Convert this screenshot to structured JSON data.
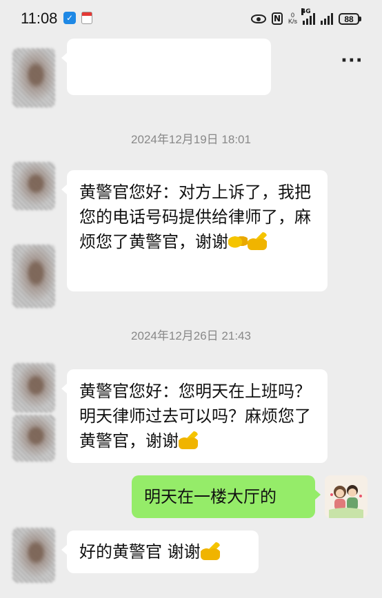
{
  "status_bar": {
    "time": "11:08",
    "net_speed_value": "0",
    "net_speed_unit": "K/s",
    "network_type": "4G",
    "battery": "88"
  },
  "header": {
    "more_label": "···"
  },
  "messages": [
    {
      "type": "timestamp",
      "text": "2024年12月19日 18:01"
    },
    {
      "type": "incoming",
      "text": "黄警官您好：对方上诉了，我把您的电话号码提供给律师了，麻烦您了黄警官，谢谢",
      "emojis": [
        "handshake",
        "folded-hands"
      ]
    },
    {
      "type": "timestamp",
      "text": "2024年12月26日 21:43"
    },
    {
      "type": "incoming",
      "text": "黄警官您好：您明天在上班吗？明天律师过去可以吗？麻烦您了黄警官，谢谢",
      "emojis": [
        "folded-hands"
      ]
    },
    {
      "type": "outgoing",
      "text": "明天在一楼大厅的"
    },
    {
      "type": "incoming",
      "text": "好的黄警官 谢谢",
      "emojis": [
        "folded-hands"
      ]
    }
  ],
  "colors": {
    "background": "#ededed",
    "outgoing_bubble": "#95ec69",
    "incoming_bubble": "#ffffff",
    "timestamp_text": "#888888"
  }
}
